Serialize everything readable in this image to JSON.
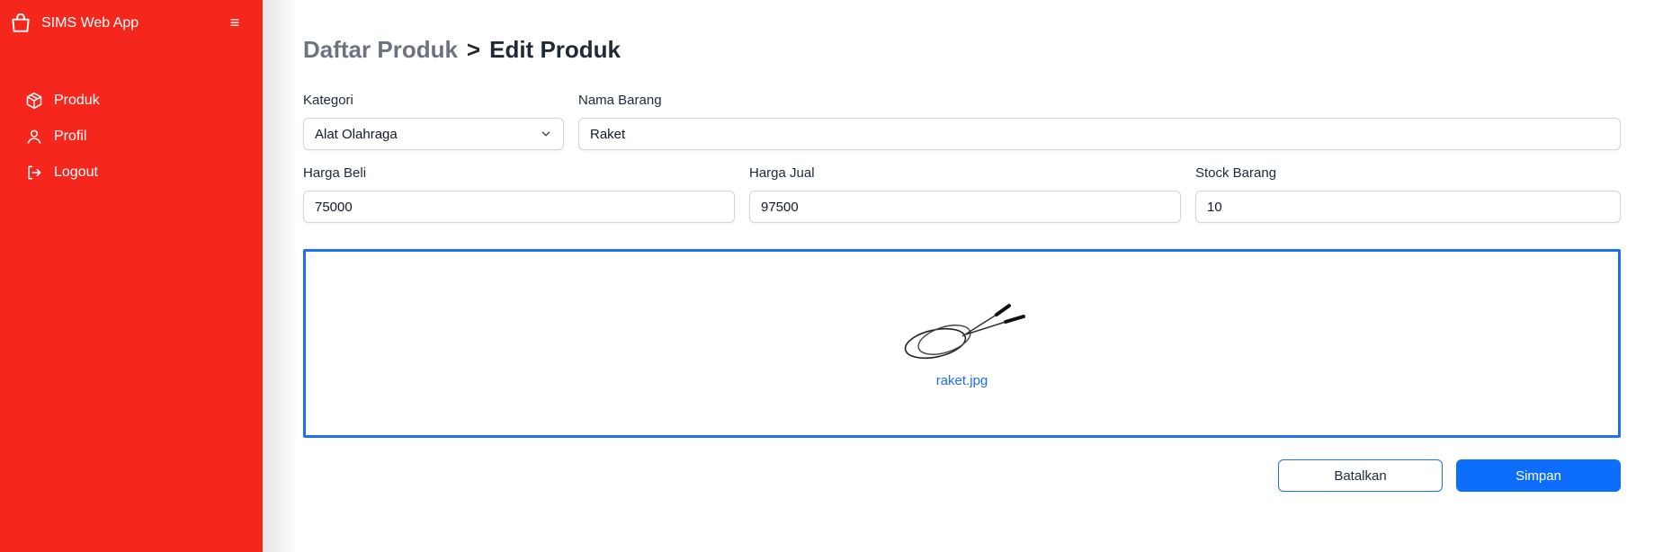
{
  "app": {
    "title": "SIMS Web App"
  },
  "sidebar": {
    "items": [
      {
        "label": "Produk",
        "icon": "box-icon"
      },
      {
        "label": "Profil",
        "icon": "user-icon"
      },
      {
        "label": "Logout",
        "icon": "logout-icon"
      }
    ]
  },
  "breadcrumb": {
    "parent": "Daftar Produk",
    "separator": ">",
    "current": "Edit Produk"
  },
  "form": {
    "kategori": {
      "label": "Kategori",
      "value": "Alat Olahraga"
    },
    "nama_barang": {
      "label": "Nama Barang",
      "value": "Raket"
    },
    "harga_beli": {
      "label": "Harga Beli",
      "value": "75000"
    },
    "harga_jual": {
      "label": "Harga Jual",
      "value": "97500"
    },
    "stock_barang": {
      "label": "Stock Barang",
      "value": "10"
    }
  },
  "upload": {
    "filename": "raket.jpg"
  },
  "actions": {
    "cancel_label": "Batalkan",
    "save_label": "Simpan"
  },
  "colors": {
    "sidebar": "#f5271d",
    "primary": "#0d6efd",
    "upload_border": "#1d6ff5"
  }
}
